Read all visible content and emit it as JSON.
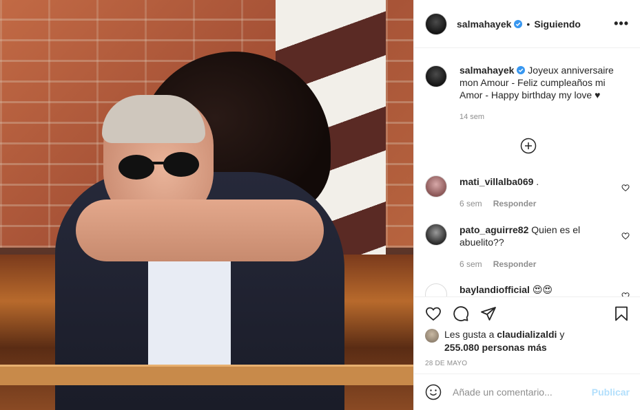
{
  "header": {
    "username": "salmahayek",
    "separator": "•",
    "follow_status": "Siguiendo",
    "more_icon": "more-horizontal-icon"
  },
  "caption": {
    "username": "salmahayek",
    "text": "Joyeux anniversaire mon Amour - Feliz cumpleaños mi Amor - Happy birthday my love ♥",
    "time": "14 sem"
  },
  "comments": [
    {
      "username": "mati_villalba069",
      "text": ".",
      "time": "6 sem",
      "reply_label": "Responder"
    },
    {
      "username": "pato_aguirre82",
      "text": "Quien es el abuelito??",
      "time": "6 sem",
      "reply_label": "Responder"
    },
    {
      "username": "baylandiofficial",
      "text": "😍😍",
      "time": "",
      "reply_label": ""
    }
  ],
  "likes": {
    "prefix": "Les gusta a",
    "liker": "claudializaldi",
    "connector": "y",
    "count_text": "255.080 personas más"
  },
  "date": "28 DE MAYO",
  "add_comment": {
    "placeholder": "Añade un comentario...",
    "publish_label": "Publicar"
  },
  "colors": {
    "verified": "#3897f0",
    "publish_disabled": "#b2dffc",
    "secondary_text": "#8e8e8e"
  }
}
